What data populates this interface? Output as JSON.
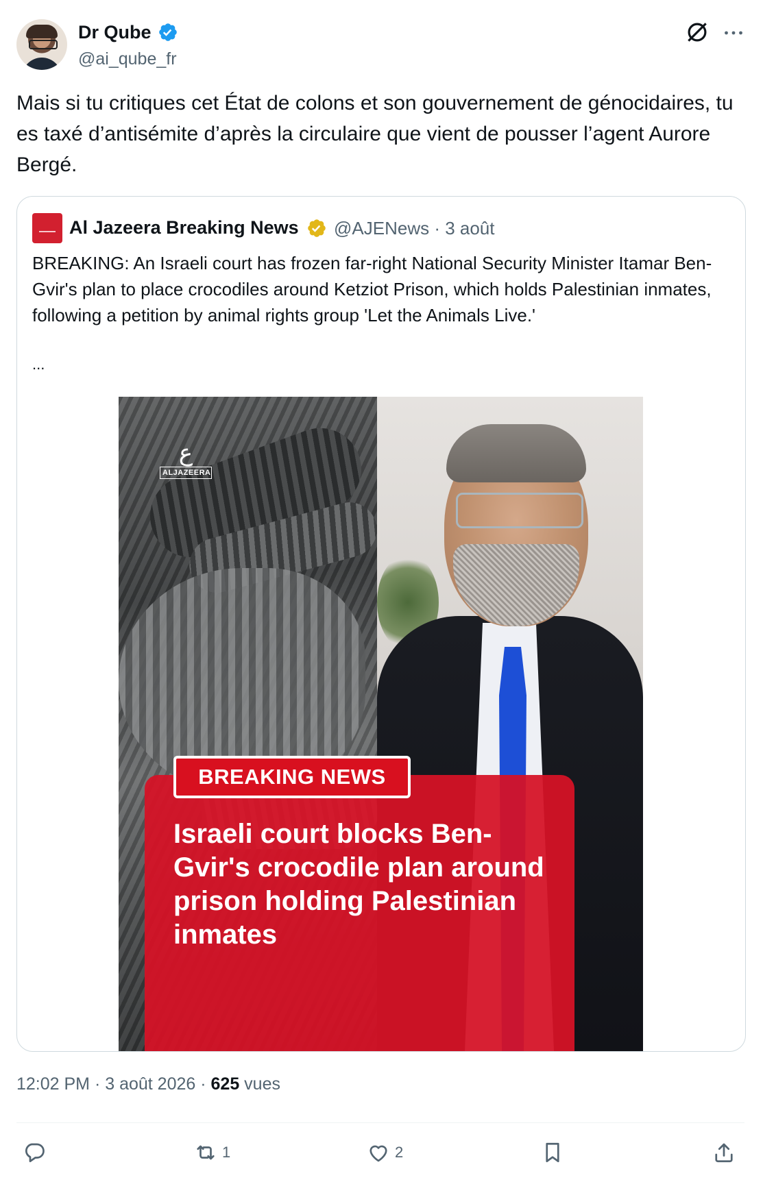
{
  "author": {
    "name": "Dr Qube",
    "handle": "@ai_qube_fr"
  },
  "tweet": {
    "text": "Mais si tu critiques cet État de colons et son gouvernement de génocidaires, tu es taxé d’antisémite d’après la circulaire que vient de pousser l’agent Aurore Bergé."
  },
  "quoted": {
    "name": "Al Jazeera Breaking News",
    "handle": "@AJENews",
    "date": "3 août",
    "meta": "@AJENews · 3 août",
    "text": "BREAKING: An Israeli court has frozen far-right National Security Minister Itamar Ben-Gvir's plan to place crocodiles around Ketziot Prison, which holds Palestinian inmates, following a petition by animal rights group 'Let the Animals Live.'",
    "more": "...",
    "image": {
      "logo_text": "ALJAZEERA",
      "banner": "BREAKING NEWS",
      "headline": "Israeli court blocks Ben-Gvir's crocodile plan around prison holding Palestinian inmates"
    }
  },
  "footer": {
    "time": "12:02 PM · 3 août 2026 · ",
    "views_count": "625",
    "views_label": " vues"
  },
  "actions": {
    "reply_count": "",
    "retweet_count": "1",
    "like_count": "2"
  },
  "colors": {
    "verified_blue": "#1d9bf0",
    "verified_gold": "#e2b719",
    "muted_text": "#536471",
    "breaking_red": "#d8101f"
  }
}
